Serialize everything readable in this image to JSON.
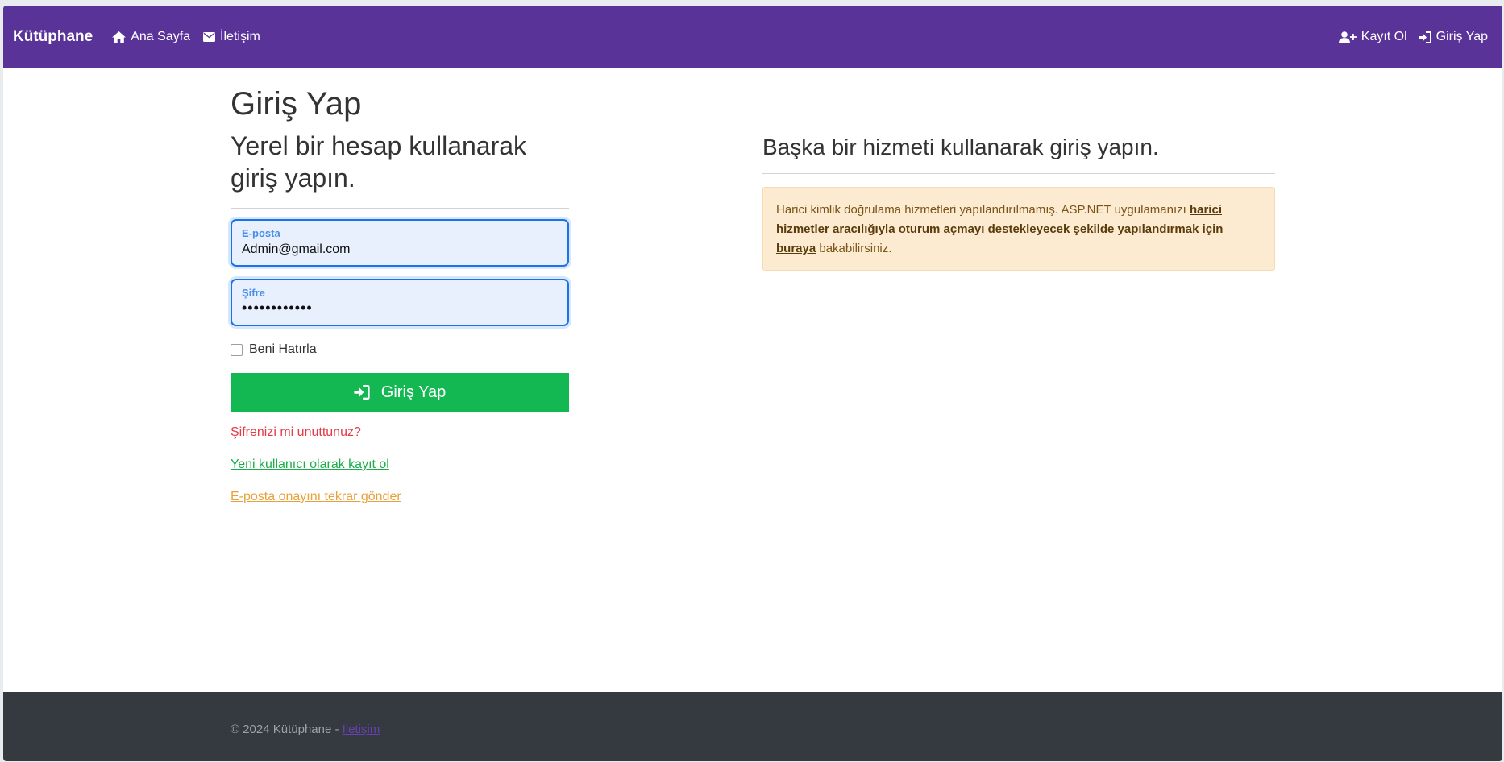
{
  "navbar": {
    "brand": "Kütüphane",
    "home": "Ana Sayfa",
    "contact": "İletişim",
    "register": "Kayıt Ol",
    "login": "Giriş Yap",
    "bg_color": "#5a3399"
  },
  "left": {
    "title": "Giriş Yap",
    "subtitle": "Yerel bir hesap kullanarak giriş yapın.",
    "email_label": "E-posta",
    "email_value": "Admin@gmail.com",
    "password_label": "Şifre",
    "password_mask": "••••••••••••",
    "remember_label": "Beni Hatırla",
    "submit_label": "Giriş Yap",
    "forgot_link": "Şifrenizi mi unuttunuz?",
    "register_link": "Yeni kullanıcı olarak kayıt ol",
    "resend_link": "E-posta onayını tekrar gönder"
  },
  "right": {
    "subtitle": "Başka bir hizmeti kullanarak giriş yapın.",
    "alert_text_1": "Harici kimlik doğrulama hizmetleri yapılandırılmamış. ASP.NET uygulamanızı ",
    "alert_link": "harici hizmetler aracılığıyla oturum açmayı destekleyecek şekilde yapılandırmak için buraya",
    "alert_text_2": " bakabilirsiniz."
  },
  "footer": {
    "text": "© 2024 Kütüphane - ",
    "link": "İletişim"
  },
  "colors": {
    "submit_button": "#14b853",
    "forgot": "#e43a45",
    "register": "#1cad4a",
    "resend": "#e8a13a",
    "footer_bg": "#343a40"
  }
}
